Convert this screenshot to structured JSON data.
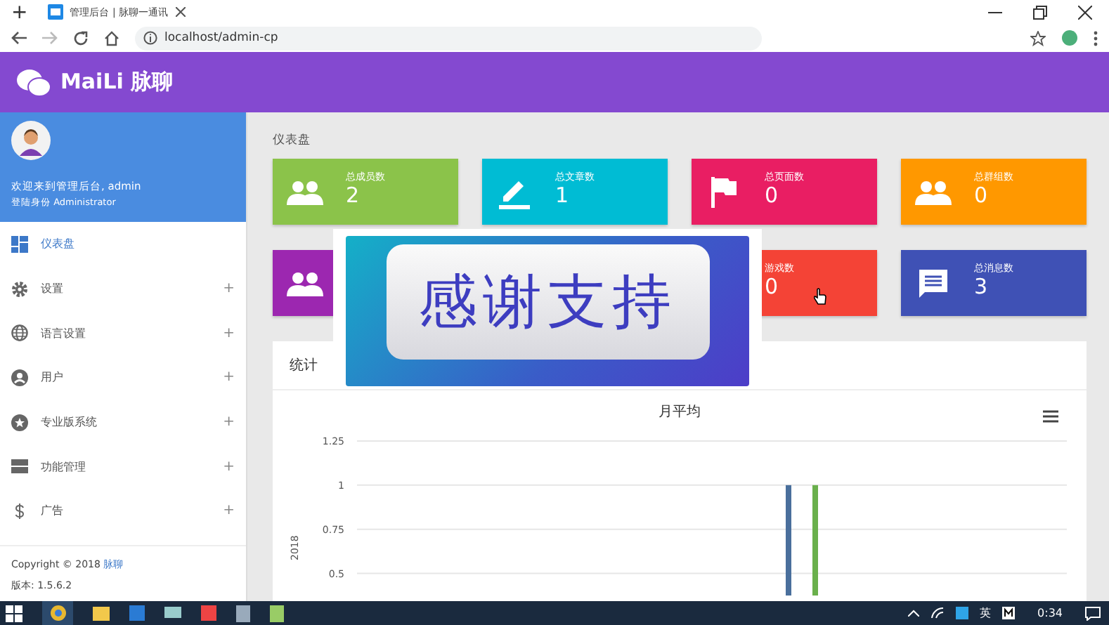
{
  "browser": {
    "new_tab": "+",
    "tab_title": "管理后台 | 脉聊一通讯",
    "url": "localhost/admin-cp"
  },
  "header": {
    "brand": "MaiLi 脉聊"
  },
  "profile": {
    "welcome": "欢迎来到管理后台, admin",
    "role": "登陆身份 Administrator"
  },
  "sidebar": {
    "items": [
      {
        "label": "仪表盘",
        "selected": true,
        "expandable": false
      },
      {
        "label": "设置",
        "selected": false,
        "expandable": true
      },
      {
        "label": "语言设置",
        "selected": false,
        "expandable": true
      },
      {
        "label": "用户",
        "selected": false,
        "expandable": true
      },
      {
        "label": "专业版系统",
        "selected": false,
        "expandable": true
      },
      {
        "label": "功能管理",
        "selected": false,
        "expandable": true
      },
      {
        "label": "广告",
        "selected": false,
        "expandable": true
      }
    ],
    "expand_glyph": "+"
  },
  "footer": {
    "copyright": "Copyright © 2018",
    "link": "脉聊",
    "version": "版本: 1.5.6.2"
  },
  "page_title": "仪表盘",
  "cards": [
    {
      "label": "总成员数",
      "value": "2",
      "color": "#8bc34a"
    },
    {
      "label": "总文章数",
      "value": "1",
      "color": "#00bcd4"
    },
    {
      "label": "总页面数",
      "value": "0",
      "color": "#e91e63"
    },
    {
      "label": "总群组数",
      "value": "0",
      "color": "#ff9800"
    },
    {
      "color": "#9c27b0"
    },
    {
      "label": "游戏数",
      "value": "0",
      "color": "#f44336"
    },
    {
      "label": "总消息数",
      "value": "3",
      "color": "#3f51b5"
    }
  ],
  "overlay": {
    "text": "感谢支持"
  },
  "stats": {
    "title": "统计",
    "chart_data": {
      "type": "bar",
      "title": "月平均",
      "ylabel": "2018",
      "ylim": [
        0.375,
        1.25
      ],
      "grid": true,
      "yticks": [
        0.5,
        0.75,
        1,
        1.25
      ],
      "series": [
        {
          "color": "#4a6f9c",
          "values": [
            1
          ]
        },
        {
          "color": "#6ab04c",
          "values": [
            1
          ]
        }
      ]
    }
  },
  "taskbar": {
    "ime": "英",
    "time": "0:34"
  }
}
